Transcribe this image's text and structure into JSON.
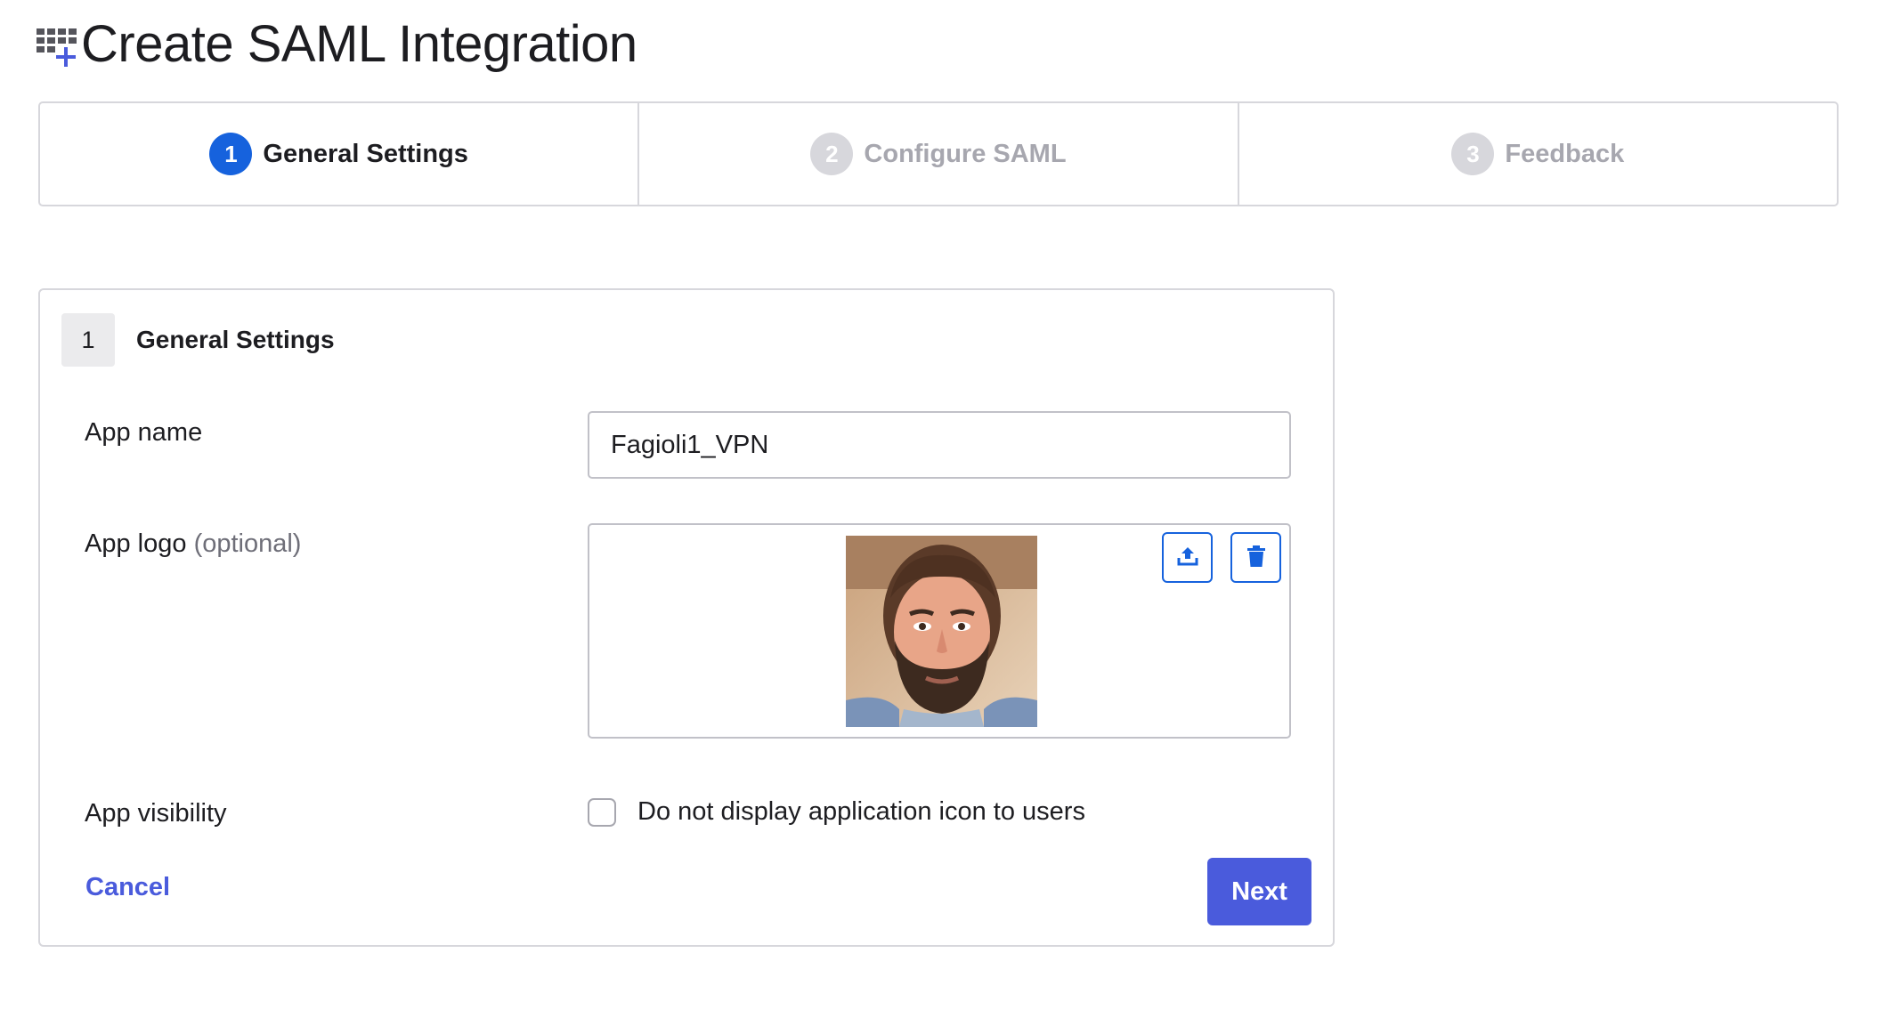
{
  "header": {
    "title": "Create SAML Integration",
    "icon": "app-grid-add-icon"
  },
  "stepper": {
    "steps": [
      {
        "number": "1",
        "label": "General Settings",
        "state": "active"
      },
      {
        "number": "2",
        "label": "Configure SAML",
        "state": "inactive"
      },
      {
        "number": "3",
        "label": "Feedback",
        "state": "inactive"
      }
    ]
  },
  "section": {
    "number": "1",
    "title": "General Settings"
  },
  "form": {
    "app_name": {
      "label": "App name",
      "value": "Fagioli1_VPN"
    },
    "app_logo": {
      "label": "App logo",
      "optional": "(optional)",
      "image": "user-portrait",
      "upload_icon": "upload-icon",
      "delete_icon": "trash-icon"
    },
    "app_visibility": {
      "label": "App visibility",
      "checkbox_label": "Do not display application icon to users",
      "checked": false
    }
  },
  "actions": {
    "cancel": "Cancel",
    "next": "Next"
  },
  "colors": {
    "primary": "#1662dd",
    "button": "#4a5bdc",
    "border": "#d7d7dc",
    "muted": "#a7a7af"
  }
}
